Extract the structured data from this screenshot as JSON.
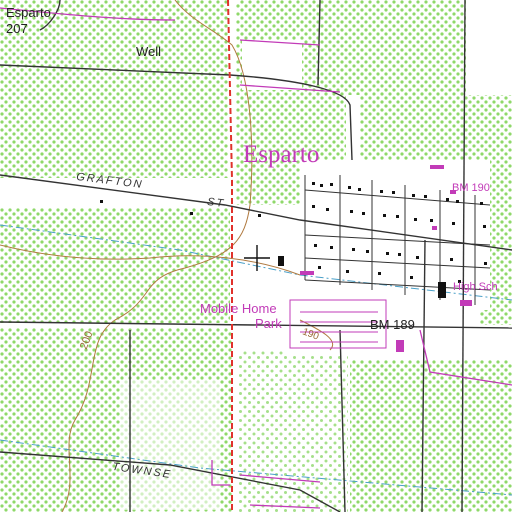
{
  "colors": {
    "background": "#ffffff",
    "vegetation": "#8fd86a",
    "road": "#333333",
    "contour": "#b07a40",
    "urban_text": "#c23bb8",
    "boundary": "#e0322c",
    "building": "#111111",
    "water": "#4aa0c8"
  },
  "labels": {
    "esparto_corner": "Esparto",
    "esparto_elev": "207",
    "well": "Well",
    "town_name": "Esparto",
    "grafton": "GRAFTON",
    "st": "ST",
    "bm190": "BM 190",
    "bm189": "BM 189",
    "high_sch": "High Sch",
    "mobile_home": "Mobile Home",
    "park": "Park",
    "contour_200": "200",
    "contour_190": "190",
    "townsend": "TOWNSE"
  },
  "icons": {
    "feature_marker": "crosshair-icon",
    "school_marker": "building-icon"
  }
}
